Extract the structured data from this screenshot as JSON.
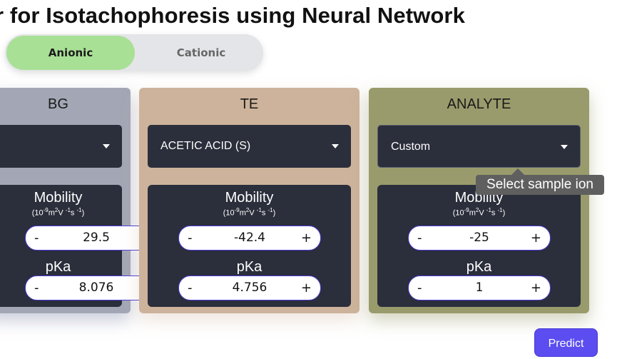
{
  "page": {
    "title": "or for Isotachophoresis using Neural Network"
  },
  "mode_toggle": {
    "options": [
      "Anionic",
      "Cationic"
    ],
    "selected": "Anionic"
  },
  "panels": {
    "bg": {
      "title": "BG",
      "selected_ion": "",
      "mobility_label": "Mobility",
      "mobility_unit": "(10-9m2V -1s -1)",
      "mobility_value": "29.5",
      "pka_label": "pKa",
      "pka_value": "8.076"
    },
    "te": {
      "title": "TE",
      "selected_ion": "ACETIC ACID (S)",
      "mobility_label": "Mobility",
      "mobility_unit": "(10-9m2V -1s -1)",
      "mobility_value": "-42.4",
      "pka_label": "pKa",
      "pka_value": "4.756"
    },
    "analyte": {
      "title": "ANALYTE",
      "selected_ion": "Custom",
      "mobility_label": "Mobility",
      "mobility_unit": "(10-9m2V -1s -1)",
      "mobility_value": "-25",
      "pka_label": "pKa",
      "pka_value": "1"
    }
  },
  "stepper": {
    "minus": "-",
    "plus": "+"
  },
  "tooltip": {
    "text": "Select sample ion"
  },
  "actions": {
    "predict_label": "Predict"
  },
  "colors": {
    "toggle_active": "#a8e096",
    "bg_panel": "#a3a7b5",
    "te_panel": "#cdb39b",
    "analyte_panel": "#999b6c",
    "inner_dark": "#2b2e3b",
    "predict": "#5b4df0"
  },
  "icons": {
    "dropdown": "chevron-down-icon"
  }
}
